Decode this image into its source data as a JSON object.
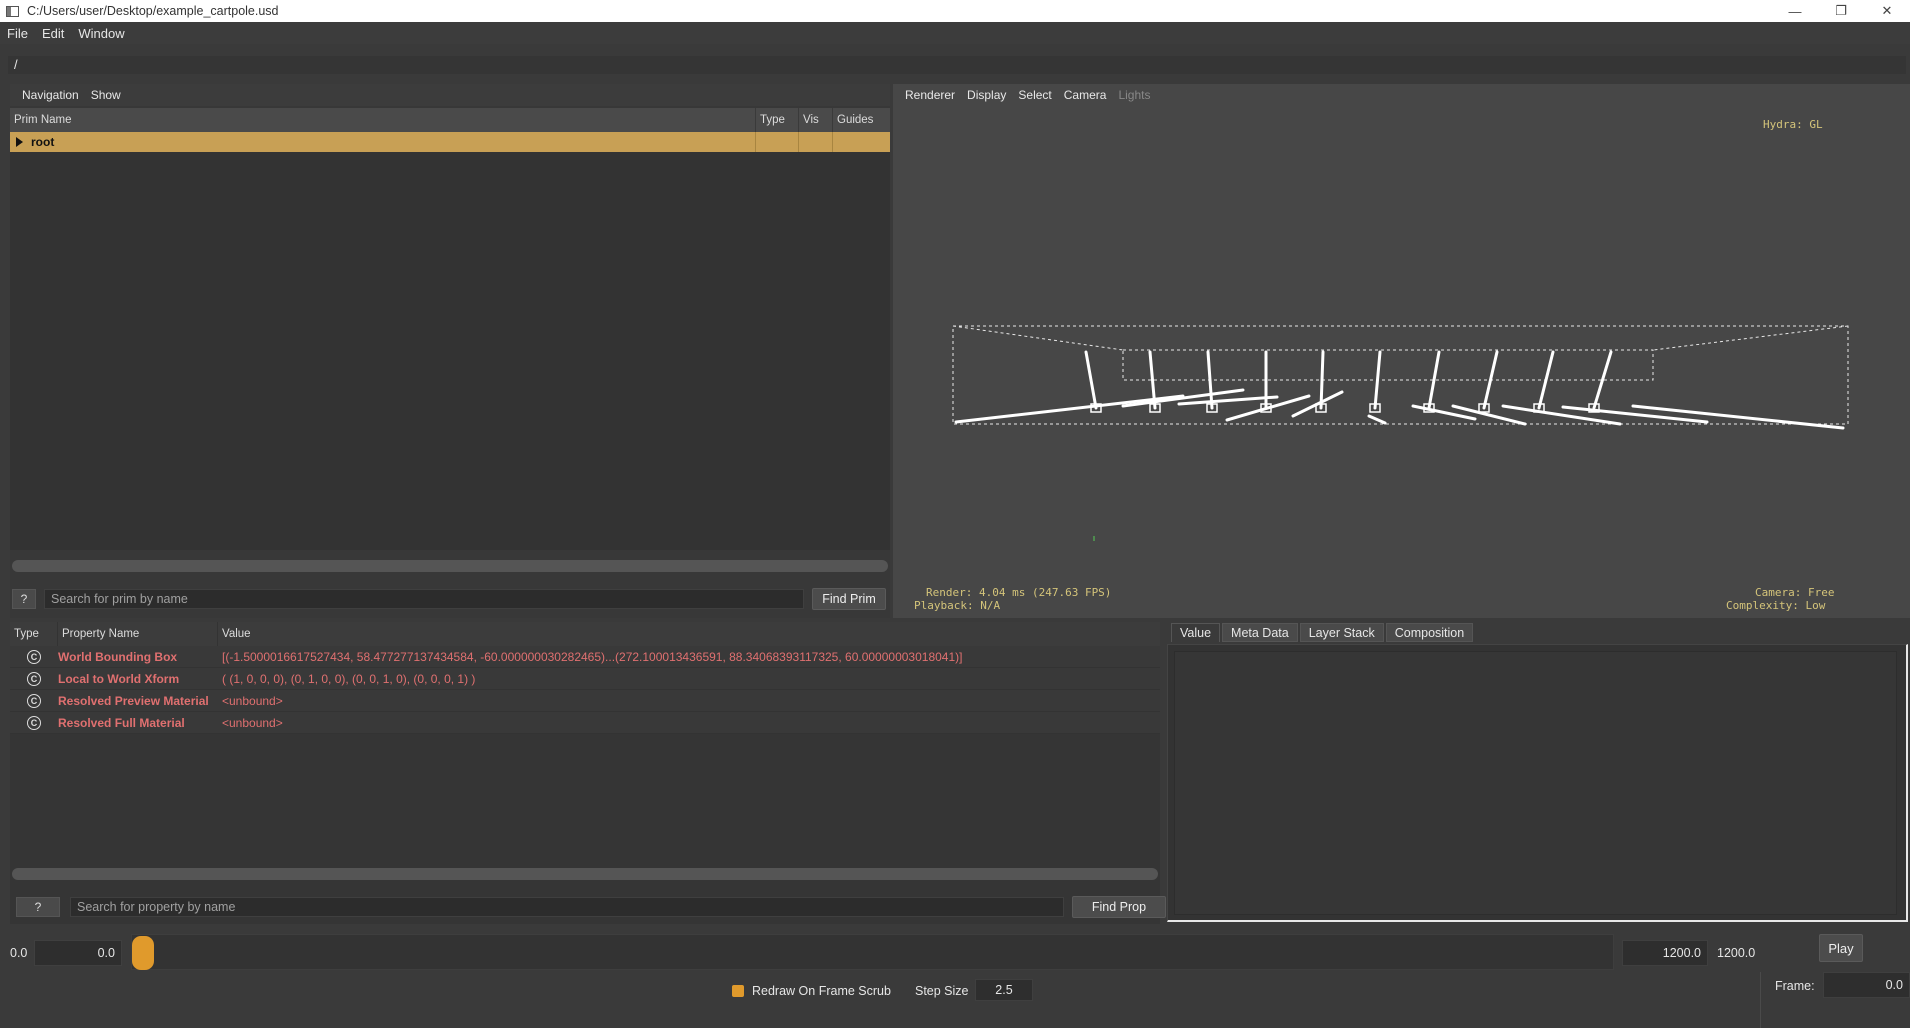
{
  "window": {
    "title": "C:/Users/user/Desktop/example_cartpole.usd",
    "controls": {
      "minimize": "—",
      "restore": "❐",
      "close": "✕"
    }
  },
  "menubar": {
    "items": [
      "File",
      "Edit",
      "Window"
    ]
  },
  "path": "/",
  "prim_browser": {
    "toolbar": [
      "Navigation",
      "Show"
    ],
    "columns": [
      "Prim Name",
      "Type",
      "Vis",
      "Guides"
    ],
    "rows": [
      {
        "name": "root",
        "type": "",
        "vis": "",
        "guides": ""
      }
    ],
    "help_label": "?",
    "search_placeholder": "Search for prim by name",
    "find_button": "Find Prim"
  },
  "viewport": {
    "toolbar": [
      {
        "label": "Renderer",
        "enabled": true
      },
      {
        "label": "Display",
        "enabled": true
      },
      {
        "label": "Select",
        "enabled": true
      },
      {
        "label": "Camera",
        "enabled": true
      },
      {
        "label": "Lights",
        "enabled": false
      }
    ],
    "hud": {
      "renderer": "Hydra: GL",
      "render_stats": "Render: 4.04 ms (247.63 FPS)",
      "playback": "Playback: N/A",
      "camera": "Camera: Free",
      "complexity": "Complexity: Low"
    },
    "colors": {
      "background": "#474747",
      "geometry": "#ffffff",
      "hud_text": "#d4c47a"
    }
  },
  "property_panel": {
    "columns": [
      "Type",
      "Property Name",
      "Value"
    ],
    "rows": [
      {
        "icon": "C",
        "name": "World Bounding Box",
        "value": "[(-1.5000016617527434, 58.477277137434584, -60.000000030282465)...(272.100013436591, 88.34068393117325, 60.00000003018041)]"
      },
      {
        "icon": "C",
        "name": "Local to World Xform",
        "value": "( (1, 0, 0, 0), (0, 1, 0, 0), (0, 0, 1, 0), (0, 0, 0, 1) )"
      },
      {
        "icon": "C",
        "name": "Resolved Preview Material",
        "value": "<unbound>"
      },
      {
        "icon": "C",
        "name": "Resolved Full Material",
        "value": "<unbound>"
      }
    ],
    "help_label": "?",
    "search_placeholder": "Search for property by name",
    "find_button": "Find Prop",
    "value_color": "#e07070"
  },
  "value_panel": {
    "tabs": [
      "Value",
      "Meta Data",
      "Layer Stack",
      "Composition"
    ],
    "active_tab": "Value"
  },
  "timeline": {
    "start_label": "0.0",
    "start_field": "0.0",
    "end_field": "1200.0",
    "end_label": "1200.0",
    "play_button": "Play",
    "redraw_label": "Redraw On Frame Scrub",
    "redraw_checked": true,
    "step_size_label": "Step Size",
    "step_size": "2.5",
    "frame_label": "Frame:",
    "frame_value": "0.0",
    "accent": "#e09a2c"
  }
}
